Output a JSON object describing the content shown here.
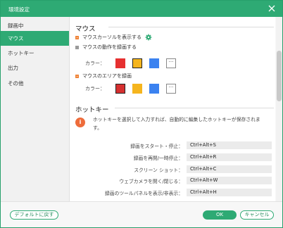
{
  "window": {
    "title": "環境設定"
  },
  "sidebar": {
    "items": [
      {
        "label": "録画中",
        "active": false
      },
      {
        "label": "マウス",
        "active": true
      },
      {
        "label": "ホットキー",
        "active": false
      },
      {
        "label": "出力",
        "active": false
      },
      {
        "label": "その他",
        "active": false
      }
    ]
  },
  "mouse": {
    "title": "マウス",
    "show_cursor": {
      "label": "マウスカーソルを表示する",
      "checked": true
    },
    "record_clicks": {
      "label": "マウスの動作を録画する",
      "checked": false
    },
    "color_label_1": "カラー：",
    "area_record": {
      "label": "マウスのエリアを録画",
      "checked": true
    },
    "color_label_2": "カラー：",
    "more_label": "···",
    "colors_1": [
      "#e63030",
      "#f5b51e",
      "#3b82f0"
    ],
    "colors_2": [
      "#d63030",
      "#f5b51e",
      "#3b82f0"
    ],
    "accent": "#2eaa74",
    "icons": {
      "settings": "gear-icon"
    }
  },
  "hotkeys": {
    "title": "ホットキー",
    "info": "ホットキーを選択して入力すれば、自動的に編集したホットキーが保存されます。",
    "rows": [
      {
        "label": "録画をスタート・停止：",
        "value": "Ctrl+Alt+S"
      },
      {
        "label": "録画を再開/一時停止：",
        "value": "Ctrl+Alt+R"
      },
      {
        "label": "スクリーン ショット：",
        "value": "Ctrl+Alt+C"
      },
      {
        "label": "ウェブカメラを開く/閉じる：",
        "value": "Ctrl+Alt+W"
      },
      {
        "label": "録画のツールパネルを表示/非表示：",
        "value": "Ctrl+Alt+H"
      }
    ]
  },
  "footer": {
    "default_label": "デフォルトに戻す",
    "ok_label": "OK",
    "cancel_label": "キャンセル"
  }
}
